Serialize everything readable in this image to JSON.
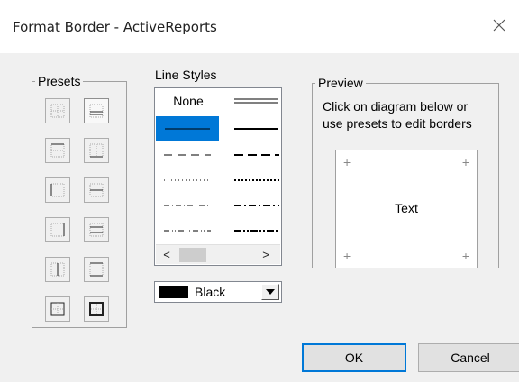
{
  "window": {
    "title": "Format Border - ActiveReports",
    "close_icon": "close-icon"
  },
  "presets": {
    "legend": "Presets",
    "buttons": [
      {
        "name": "preset-no-border",
        "icon": "border-none-icon"
      },
      {
        "name": "preset-double-bottom",
        "icon": "border-double-bottom-icon"
      },
      {
        "name": "preset-top-border",
        "icon": "border-top-icon"
      },
      {
        "name": "preset-bottom-border",
        "icon": "border-bottom-icon"
      },
      {
        "name": "preset-left-border",
        "icon": "border-left-icon"
      },
      {
        "name": "preset-horizontal-inner",
        "icon": "border-horizontal-inner-icon"
      },
      {
        "name": "preset-right-border",
        "icon": "border-right-icon"
      },
      {
        "name": "preset-lines",
        "icon": "border-lines-icon"
      },
      {
        "name": "preset-vertical-inner",
        "icon": "border-vertical-inner-icon"
      },
      {
        "name": "preset-top-bottom",
        "icon": "border-top-bottom-icon"
      },
      {
        "name": "preset-inside",
        "icon": "border-inside-icon"
      },
      {
        "name": "preset-outline",
        "icon": "border-outline-icon"
      }
    ]
  },
  "line_styles": {
    "label": "Line Styles",
    "none_label": "None",
    "items": [
      {
        "name": "none",
        "selected": false
      },
      {
        "name": "double",
        "selected": false
      },
      {
        "name": "thin-solid",
        "selected": true
      },
      {
        "name": "thick-solid",
        "selected": false
      },
      {
        "name": "thin-dash",
        "selected": false
      },
      {
        "name": "thick-dash",
        "selected": false
      },
      {
        "name": "thin-dot",
        "selected": false
      },
      {
        "name": "thick-dot",
        "selected": false
      },
      {
        "name": "thin-dash-dot",
        "selected": false
      },
      {
        "name": "thick-dash-dot",
        "selected": false
      },
      {
        "name": "thin-dash-dot-dot",
        "selected": false
      },
      {
        "name": "thick-dash-dot-dot",
        "selected": false
      }
    ],
    "scroll_left_glyph": "<",
    "scroll_right_glyph": ">"
  },
  "color": {
    "value": "Black",
    "swatch": "#000000",
    "dropdown_icon": "dropdown-arrow-icon"
  },
  "preview": {
    "legend": "Preview",
    "instruction_line1": "Click on diagram below or",
    "instruction_line2": "use presets to edit borders",
    "sample_text": "Text",
    "corner_mark": "+"
  },
  "buttons": {
    "ok": "OK",
    "cancel": "Cancel"
  },
  "colors": {
    "selection": "#0078d7",
    "dialog_bg": "#f0f0f0",
    "titlebar_bg": "#ffffff"
  }
}
